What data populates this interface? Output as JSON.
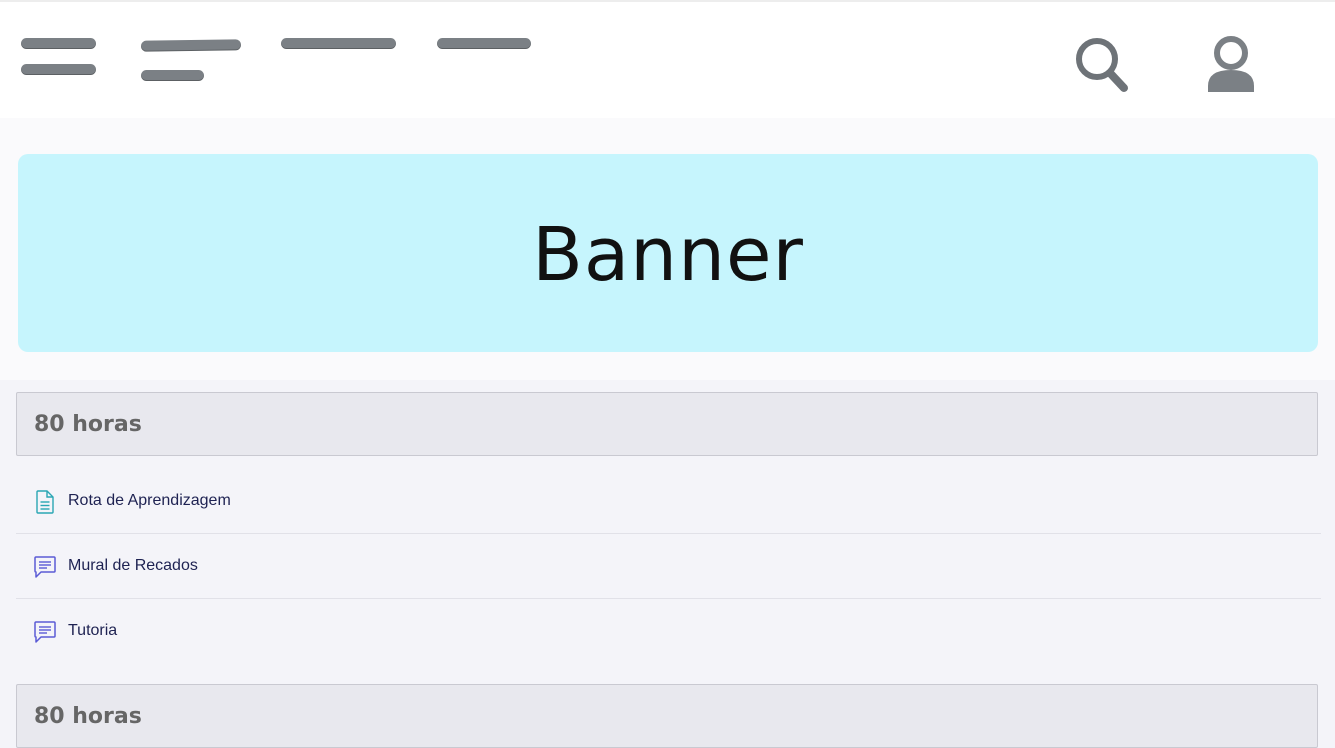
{
  "header": {
    "nav_icon_names": [
      "hamburger-icon",
      "nav-placeholder-2",
      "nav-placeholder-3",
      "nav-placeholder-4"
    ],
    "search_icon": "search-icon",
    "user_icon": "user-icon",
    "bar_color": "#7b8085"
  },
  "banner": {
    "text": "Banner",
    "background": "#c6f5fd"
  },
  "sections": [
    {
      "title": "80 horas",
      "items": [
        {
          "label": "Rota de Aprendizagem",
          "icon": "document-icon",
          "icon_color": "#2aa6b4"
        },
        {
          "label": "Mural de Recados",
          "icon": "forum-icon",
          "icon_color": "#5b5bd6"
        },
        {
          "label": "Tutoria",
          "icon": "forum-icon",
          "icon_color": "#5b5bd6"
        }
      ]
    },
    {
      "title": "80 horas",
      "items": []
    }
  ]
}
